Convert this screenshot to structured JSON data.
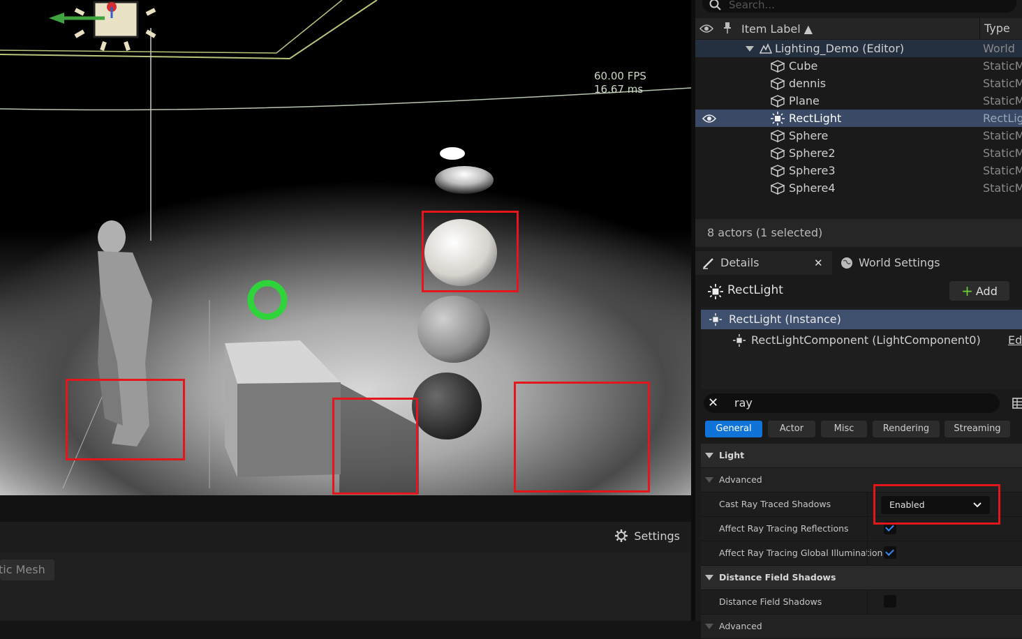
{
  "viewport": {
    "fps": "60.00 FPS",
    "ms": "16.67 ms",
    "settings_label": "Settings",
    "mesh_chip": "tic Mesh"
  },
  "outliner": {
    "search_placeholder": "Search...",
    "col_label": "Item Label ▲",
    "col_type": "Type",
    "items": [
      {
        "label": "Lighting_Demo (Editor)",
        "type": "World",
        "icon": "level-icon"
      },
      {
        "label": "Cube",
        "type": "StaticM",
        "icon": "static-mesh-icon"
      },
      {
        "label": "dennis",
        "type": "StaticM",
        "icon": "static-mesh-icon"
      },
      {
        "label": "Plane",
        "type": "StaticM",
        "icon": "static-mesh-icon"
      },
      {
        "label": "RectLight",
        "type": "RectLig",
        "icon": "light-icon"
      },
      {
        "label": "Sphere",
        "type": "StaticM",
        "icon": "static-mesh-icon"
      },
      {
        "label": "Sphere2",
        "type": "StaticM",
        "icon": "static-mesh-icon"
      },
      {
        "label": "Sphere3",
        "type": "StaticM",
        "icon": "static-mesh-icon"
      },
      {
        "label": "Sphere4",
        "type": "StaticM",
        "icon": "static-mesh-icon"
      }
    ],
    "actors_count": "8 actors (1 selected)"
  },
  "details": {
    "tab_details": "Details",
    "tab_world": "World Settings",
    "actor_name": "RectLight",
    "add_label": "Add",
    "instance_label": "RectLight (Instance)",
    "component_label": "RectLightComponent (LightComponent0)",
    "edit_label": "Edi",
    "filter_value": "ray",
    "categories": [
      "General",
      "Actor",
      "Misc",
      "Rendering",
      "Streaming"
    ],
    "active_category": "General",
    "sections": {
      "light": "Light",
      "advanced": "Advanced",
      "cast_label": "Cast Ray Traced Shadows",
      "cast_value": "Enabled",
      "reflections_label": "Affect Ray Tracing Reflections",
      "gi_label": "Affect Ray Tracing Global Illumination",
      "dfs_section": "Distance Field Shadows",
      "dfs_label": "Distance Field Shadows",
      "advanced2": "Advanced"
    }
  },
  "colors": {
    "highlight_red": "#e3161b",
    "accent_blue": "#0f73d8",
    "selection": "#3a4a66"
  }
}
